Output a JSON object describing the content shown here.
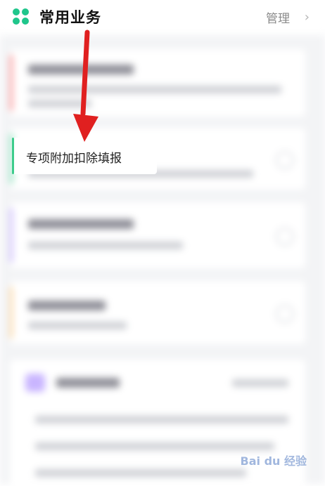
{
  "header": {
    "title": "常用业务",
    "manage_label": "管理",
    "chevron": "›"
  },
  "focused_item": {
    "label": "专项附加扣除填报"
  },
  "watermark": "Bai du 经验",
  "colors": {
    "accent_green": "#1fc68b",
    "arrow_red": "#e02020"
  }
}
